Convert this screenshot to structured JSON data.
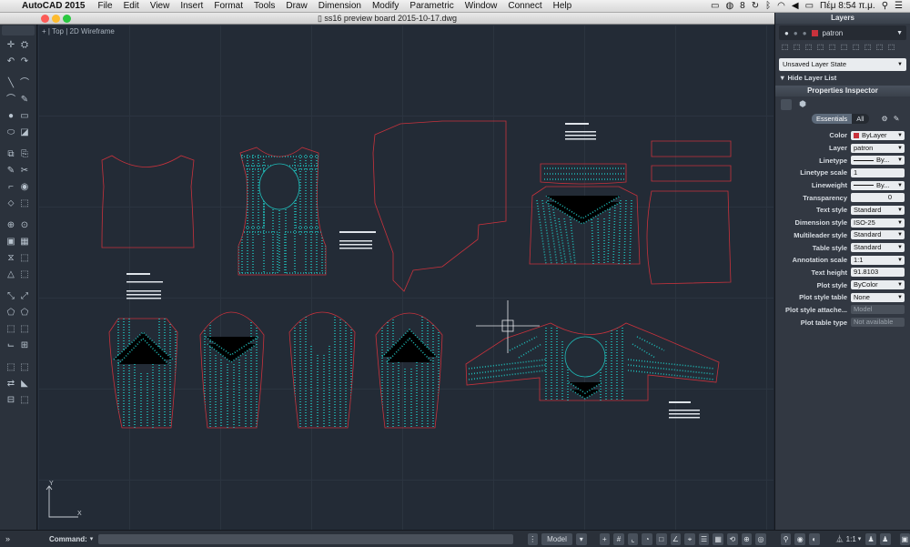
{
  "menubar": {
    "app_name": "AutoCAD 2015",
    "items": [
      "File",
      "Edit",
      "View",
      "Insert",
      "Format",
      "Tools",
      "Draw",
      "Dimension",
      "Modify",
      "Parametric",
      "Window",
      "Connect",
      "Help"
    ],
    "status": {
      "badge": "8",
      "clock": "Πέμ 8:54 π.μ."
    }
  },
  "window": {
    "title": "ss16 preview board 2015-10-17.dwg"
  },
  "viewport": {
    "plus": "+",
    "view": "Top",
    "style": "2D Wireframe"
  },
  "layers_panel": {
    "title": "Layers",
    "current_layer": "patron",
    "layer_state": "Unsaved Layer State",
    "hide_list": "Hide Layer List"
  },
  "properties": {
    "title": "Properties Inspector",
    "tabs": [
      "Essentials",
      "All"
    ],
    "rows": [
      {
        "label": "Color",
        "value": "ByLayer"
      },
      {
        "label": "Layer",
        "value": "patron"
      },
      {
        "label": "Linetype",
        "value": "By..."
      },
      {
        "label": "Linetype scale",
        "value": "1"
      },
      {
        "label": "Lineweight",
        "value": "By..."
      },
      {
        "label": "Transparency",
        "value": "0"
      },
      {
        "label": "Text style",
        "value": "Standard"
      },
      {
        "label": "Dimension style",
        "value": "ISO-25"
      },
      {
        "label": "Multileader style",
        "value": "Standard"
      },
      {
        "label": "Table style",
        "value": "Standard"
      },
      {
        "label": "Annotation scale",
        "value": "1:1"
      },
      {
        "label": "Text height",
        "value": "91.8103"
      },
      {
        "label": "Plot style",
        "value": "ByColor"
      },
      {
        "label": "Plot style table",
        "value": "None"
      },
      {
        "label": "Plot style attache...",
        "value": "Model"
      },
      {
        "label": "Plot table type",
        "value": "Not available"
      }
    ]
  },
  "statusbar": {
    "command_label": "Command:",
    "model": "Model",
    "scale": "1:1"
  },
  "colors": {
    "pattern_outline": "#c8323c",
    "pattern_fill": "#1fb8b5",
    "canvas": "#232b36"
  }
}
